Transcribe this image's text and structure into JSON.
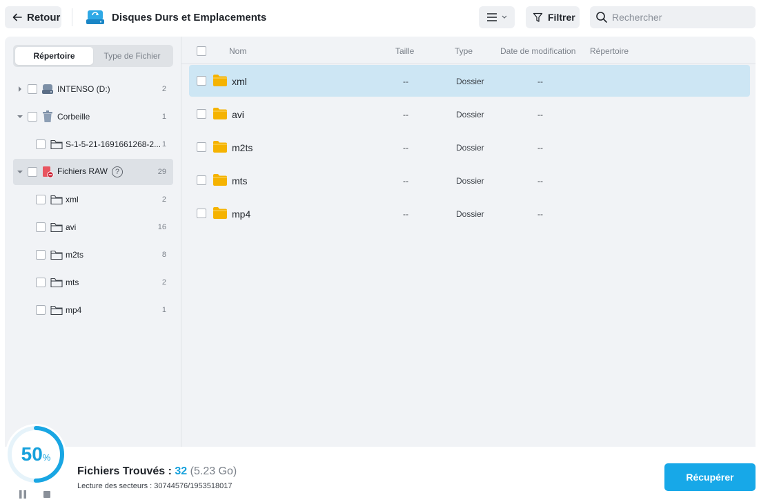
{
  "header": {
    "back_label": "Retour",
    "title": "Disques Durs et Emplacements",
    "filter_label": "Filtrer",
    "search_placeholder": "Rechercher",
    "search_value": ""
  },
  "tabs": [
    {
      "label": "Répertoire",
      "active": true
    },
    {
      "label": "Type de Fichier",
      "active": false
    }
  ],
  "tree": [
    {
      "label": "INTENSO (D:)",
      "count": "2",
      "icon": "drive-icon",
      "expanded": false
    },
    {
      "label": "Corbeille",
      "count": "1",
      "icon": "trash-icon",
      "expanded": true
    },
    {
      "label": "S-1-5-21-1691661268-2...",
      "count": "1",
      "icon": "folder-icon"
    },
    {
      "label": "Fichiers RAW",
      "count": "29",
      "icon": "raw-files-icon",
      "expanded": true,
      "selected": true
    },
    {
      "label": "xml",
      "count": "2",
      "icon": "folder-icon"
    },
    {
      "label": "avi",
      "count": "16",
      "icon": "folder-icon"
    },
    {
      "label": "m2ts",
      "count": "8",
      "icon": "folder-icon"
    },
    {
      "label": "mts",
      "count": "2",
      "icon": "folder-icon"
    },
    {
      "label": "mp4",
      "count": "1",
      "icon": "folder-icon"
    }
  ],
  "help_glyph": "?",
  "columns": {
    "name": "Nom",
    "size": "Taille",
    "type": "Type",
    "date": "Date de modification",
    "directory": "Répertoire"
  },
  "rows": [
    {
      "name": "xml",
      "size": "--",
      "type": "Dossier",
      "date": "--",
      "selected": true
    },
    {
      "name": "avi",
      "size": "--",
      "type": "Dossier",
      "date": "--"
    },
    {
      "name": "m2ts",
      "size": "--",
      "type": "Dossier",
      "date": "--"
    },
    {
      "name": "mts",
      "size": "--",
      "type": "Dossier",
      "date": "--"
    },
    {
      "name": "mp4",
      "size": "--",
      "type": "Dossier",
      "date": "--"
    }
  ],
  "footer": {
    "progress_value": "50",
    "progress_sign": "%",
    "found_label": "Fichiers Trouvés :",
    "found_count": "32",
    "found_size": "(5.23 Go)",
    "sectors_label": "Lecture des secteurs : 30744576/1953518017",
    "recover_label": "Récupérer"
  },
  "colors": {
    "accent": "#17a8e8",
    "selected_row": "#cde6f4",
    "folder": "#f5b301"
  }
}
